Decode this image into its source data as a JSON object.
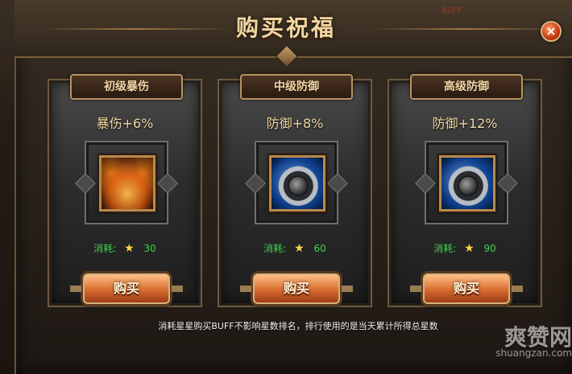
{
  "dialog": {
    "title": "购买祝福",
    "close_icon": "close-icon",
    "background_text": "BUFF"
  },
  "cards": [
    {
      "name": "初级暴伤",
      "effect": "暴伤+6%",
      "icon": "critical-fire-icon",
      "cost_label": "消耗:",
      "cost_value": "30",
      "button_label": "购买"
    },
    {
      "name": "中级防御",
      "effect": "防御+8%",
      "icon": "defense-shield-icon",
      "cost_label": "消耗:",
      "cost_value": "60",
      "button_label": "购买"
    },
    {
      "name": "高级防御",
      "effect": "防御+12%",
      "icon": "defense-shield-icon",
      "cost_label": "消耗:",
      "cost_value": "90",
      "button_label": "购买"
    }
  ],
  "footer": {
    "note": "消耗星星购买BUFF不影响星数排名，排行使用的是当天累计所得总星数"
  },
  "watermark": {
    "main": "爽赞网",
    "sub": "shuangzan.com"
  }
}
